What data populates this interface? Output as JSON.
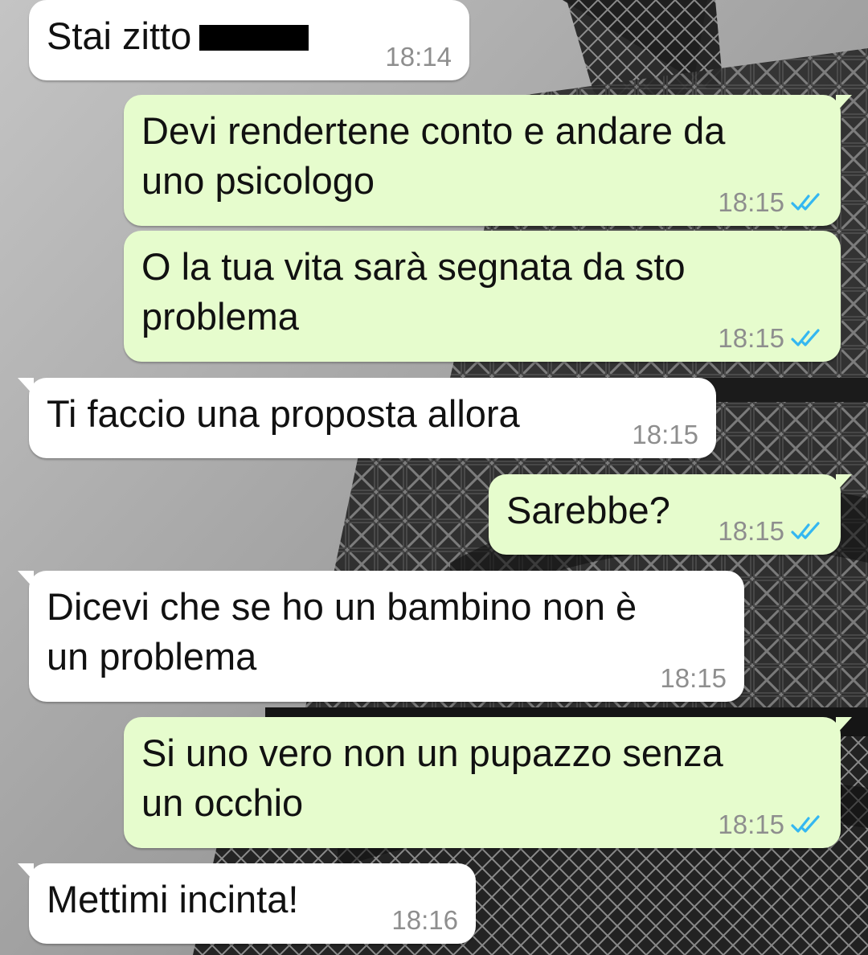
{
  "colors": {
    "incoming_bubble": "#ffffff",
    "outgoing_bubble": "#e6fccd",
    "timestamp": "#8e8e8e",
    "read_ticks": "#34b7f1"
  },
  "icons": {
    "read_receipt": "double-check-icon"
  },
  "messages": [
    {
      "direction": "in",
      "text": "Stai zitto",
      "redacted": true,
      "time": "18:14"
    },
    {
      "direction": "out",
      "text": "Devi rendertene conto e andare da\nuno psicologo",
      "time": "18:15",
      "status": "read"
    },
    {
      "direction": "out",
      "text": "O la tua vita sarà segnata da sto\nproblema",
      "time": "18:15",
      "status": "read"
    },
    {
      "direction": "in",
      "text": "Ti faccio una proposta allora",
      "time": "18:15"
    },
    {
      "direction": "out",
      "text": "Sarebbe?",
      "time": "18:15",
      "status": "read"
    },
    {
      "direction": "in",
      "text": "Dicevi che se ho un bambino non è\nun problema",
      "time": "18:15"
    },
    {
      "direction": "out",
      "text": "Si uno vero non un pupazzo senza\nun occhio",
      "time": "18:15",
      "status": "read"
    },
    {
      "direction": "in",
      "text": "Mettimi incinta!",
      "time": "18:16"
    }
  ]
}
